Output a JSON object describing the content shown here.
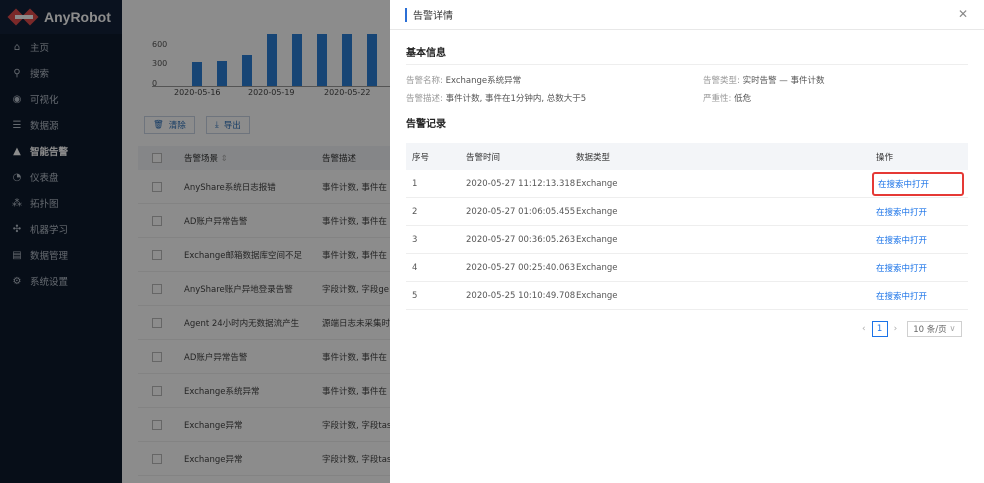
{
  "app": {
    "name": "AnyRobot"
  },
  "sidebar": {
    "items": [
      {
        "label": "主页",
        "icon": "home-icon",
        "glyph": "⌂"
      },
      {
        "label": "搜索",
        "icon": "search-icon",
        "glyph": "⚲"
      },
      {
        "label": "可视化",
        "icon": "eye-icon",
        "glyph": "◉"
      },
      {
        "label": "数据源",
        "icon": "database-icon",
        "glyph": "☰"
      },
      {
        "label": "智能告警",
        "icon": "alert-icon",
        "glyph": "▲",
        "active": true
      },
      {
        "label": "仪表盘",
        "icon": "dashboard-icon",
        "glyph": "◔"
      },
      {
        "label": "拓扑图",
        "icon": "topology-icon",
        "glyph": "⁂"
      },
      {
        "label": "机器学习",
        "icon": "ml-icon",
        "glyph": "✣"
      },
      {
        "label": "数据管理",
        "icon": "data-manage-icon",
        "glyph": "▤"
      },
      {
        "label": "系统设置",
        "icon": "settings-icon",
        "glyph": "⚙"
      }
    ]
  },
  "background": {
    "chart": {
      "y_ticks": [
        "600",
        "300",
        "0"
      ],
      "x_ticks": [
        "2020-05-16",
        "2020-05-19",
        "2020-05-22"
      ]
    },
    "clear_label": "清除",
    "export_label": "导出",
    "columns": [
      "告警场景",
      "告警描述"
    ],
    "rows": [
      {
        "name": "AnyShare系统日志报错",
        "desc": "事件计数, 事件在"
      },
      {
        "name": "AD账户异常告警",
        "desc": "事件计数, 事件在"
      },
      {
        "name": "Exchange邮箱数据库空间不足",
        "desc": "事件计数, 事件在"
      },
      {
        "name": "AnyShare账户异地登录告警",
        "desc": "字段计数, 字段ge"
      },
      {
        "name": "Agent 24小时内无数据流产生",
        "desc": "源端日志未采集时"
      },
      {
        "name": "AD账户异常告警",
        "desc": "事件计数, 事件在"
      },
      {
        "name": "Exchange系统异常",
        "desc": "事件计数, 事件在"
      },
      {
        "name": "Exchange异常",
        "desc": "字段计数, 字段tas"
      },
      {
        "name": "Exchange异常",
        "desc": "字段计数, 字段tas"
      }
    ]
  },
  "drawer": {
    "title": "告警详情",
    "basic_title": "基本信息",
    "alert_name_label": "告警名称:",
    "alert_name_value": "Exchange系统异常",
    "alert_type_label": "告警类型:",
    "alert_type_value": "实时告警 — 事件计数",
    "alert_desc_label": "告警描述:",
    "alert_desc_value": "事件计数, 事件在1分钟内, 总数大于5",
    "severity_label": "严重性:",
    "severity_value": "低危",
    "records_title": "告警记录",
    "columns": {
      "no": "序号",
      "time": "告警时间",
      "type": "数据类型",
      "op": "操作"
    },
    "records": [
      {
        "no": "1",
        "time": "2020-05-27 11:12:13.318",
        "type": "Exchange",
        "op": "在搜索中打开"
      },
      {
        "no": "2",
        "time": "2020-05-27 01:06:05.455",
        "type": "Exchange",
        "op": "在搜索中打开"
      },
      {
        "no": "3",
        "time": "2020-05-27 00:36:05.263",
        "type": "Exchange",
        "op": "在搜索中打开"
      },
      {
        "no": "4",
        "time": "2020-05-27 00:25:40.063",
        "type": "Exchange",
        "op": "在搜索中打开"
      },
      {
        "no": "5",
        "time": "2020-05-25 10:10:49.708",
        "type": "Exchange",
        "op": "在搜索中打开"
      }
    ],
    "pagination": {
      "current": "1",
      "page_size": "10 条/页"
    }
  }
}
